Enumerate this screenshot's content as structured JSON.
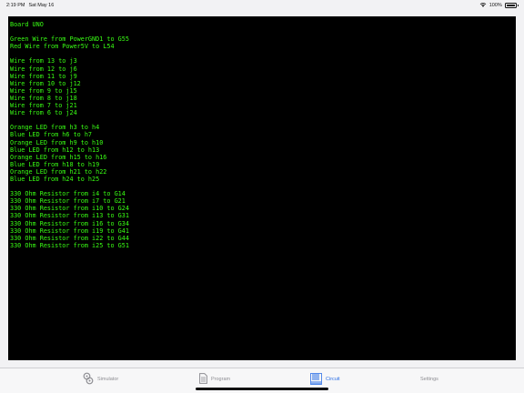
{
  "status_bar": {
    "time": "2:19 PM",
    "date": "Sat May 16",
    "battery": "100%",
    "icons": [
      "wifi-icon",
      "battery-icon"
    ]
  },
  "terminal": {
    "lines": [
      "Board UNO",
      "",
      "Green Wire from PowerGND1 to G55",
      "Red Wire from Power5V to L54",
      "",
      "Wire from 13 to j3",
      "Wire from 12 to j6",
      "Wire from 11 to j9",
      "Wire from 10 to j12",
      "Wire from 9 to j15",
      "Wire from 8 to j18",
      "Wire from 7 to j21",
      "Wire from 6 to j24",
      "",
      "Orange LED from h3 to h4",
      "Blue LED from h6 to h7",
      "Orange LED from h9 to h10",
      "Blue LED from h12 to h13",
      "Orange LED from h15 to h16",
      "Blue LED from h18 to h19",
      "Orange LED from h21 to h22",
      "Blue LED from h24 to h25",
      "",
      "330 Ohm Resistor from i4 to G14",
      "330 Ohm Resistor from i7 to G21",
      "330 Ohm Resistor from i10 to G24",
      "330 Ohm Resistor from i13 to G31",
      "330 Ohm Resistor from i16 to G34",
      "330 Ohm Resistor from i19 to G41",
      "330 Ohm Resistor from i22 to G44",
      "330 Ohm Resistor from i25 to G51"
    ],
    "text_color": "#39ff14",
    "background": "#000000"
  },
  "tab_bar": {
    "tabs": [
      {
        "label": "Simulator",
        "icon": "simulator-icon",
        "active": false
      },
      {
        "label": "Program",
        "icon": "document-icon",
        "active": false
      },
      {
        "label": "Circuit",
        "icon": "circuit-icon",
        "active": true
      },
      {
        "label": "Settings",
        "icon": "",
        "active": false
      }
    ],
    "active_color": "#2b6fe6",
    "inactive_color": "#8e8e93"
  }
}
